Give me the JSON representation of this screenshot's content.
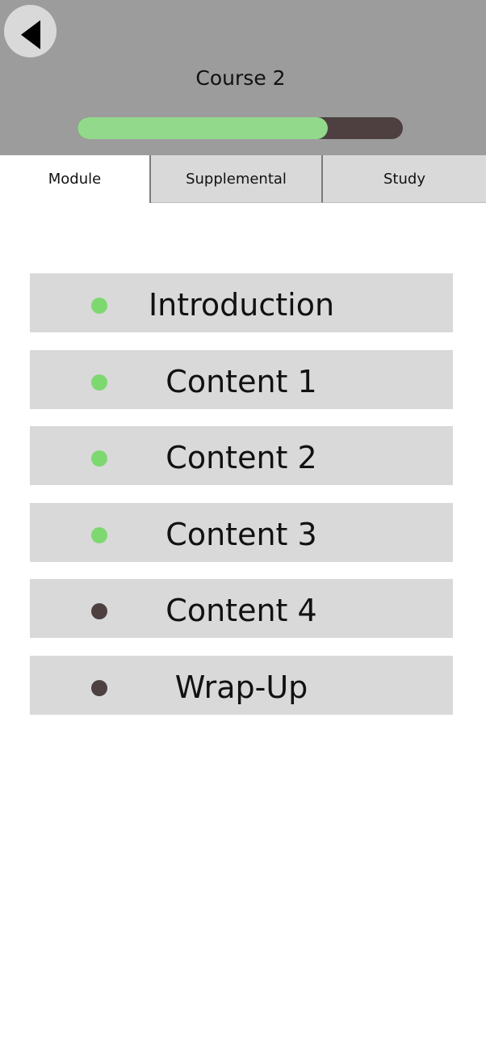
{
  "header": {
    "back_icon": "back-triangle-icon",
    "course_title": "Course 2",
    "progress_fraction": 0.77,
    "progress_fill_color": "#92d98c",
    "progress_track_color": "#4e4040"
  },
  "tabs": [
    {
      "label": "Module",
      "active": true
    },
    {
      "label": "Supplemental",
      "active": false
    },
    {
      "label": "Study",
      "active": false
    }
  ],
  "modules": [
    {
      "label": "Introduction",
      "status": "complete"
    },
    {
      "label": "Content 1",
      "status": "complete"
    },
    {
      "label": "Content 2",
      "status": "complete"
    },
    {
      "label": "Content 3",
      "status": "complete"
    },
    {
      "label": "Content 4",
      "status": "incomplete"
    },
    {
      "label": "Wrap-Up",
      "status": "incomplete"
    }
  ],
  "status_colors": {
    "complete": "#7dd870",
    "incomplete": "#4e4040"
  }
}
